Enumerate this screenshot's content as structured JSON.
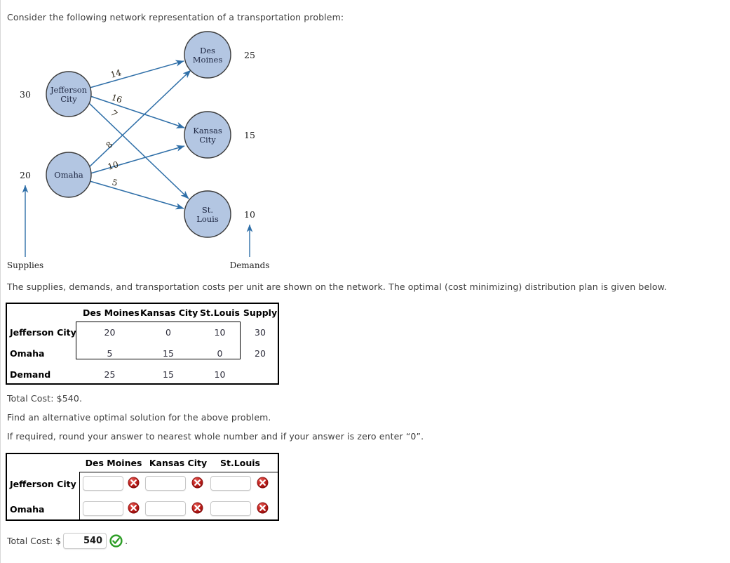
{
  "intro": {
    "text": "Consider the following network representation of a transportation problem:"
  },
  "network": {
    "supplies_label": "Supplies",
    "demands_label": "Demands",
    "sources": [
      {
        "name_line1": "Jefferson",
        "name_line2": "City",
        "supply": "30"
      },
      {
        "name_line1": "Omaha",
        "name_line2": "",
        "supply": "20"
      }
    ],
    "destinations": [
      {
        "name_line1": "Des",
        "name_line2": "Moines",
        "demand": "25"
      },
      {
        "name_line1": "Kansas",
        "name_line2": "City",
        "demand": "15"
      },
      {
        "name_line1": "St.",
        "name_line2": "Louis",
        "demand": "10"
      }
    ],
    "arc_costs": {
      "jefferson_des_moines": "14",
      "jefferson_kansas_city": "16",
      "jefferson_st_louis": "7",
      "omaha_des_moines": "8",
      "omaha_kansas_city": "10",
      "omaha_st_louis": "5"
    },
    "node_fill": "#b3c6e2",
    "node_stroke": "#3b3b3b",
    "arc_color": "#2f6fa8"
  },
  "description": {
    "text": "The supplies, demands, and transportation costs per unit are shown on the network. The optimal (cost minimizing) distribution plan is given below."
  },
  "solution_table": {
    "headers": [
      "",
      "Des Moines",
      "Kansas City",
      "St.Louis",
      "Supply"
    ],
    "rows": [
      {
        "label": "Jefferson City",
        "values": [
          "20",
          "0",
          "10"
        ],
        "supply": "30"
      },
      {
        "label": "Omaha",
        "values": [
          "5",
          "15",
          "0"
        ],
        "supply": "20"
      }
    ],
    "demand_row": {
      "label": "Demand",
      "values": [
        "25",
        "15",
        "10"
      ]
    }
  },
  "total_cost_static": {
    "text": "Total Cost: $540."
  },
  "question": {
    "find_alternative": "Find an alternative optimal solution for the above problem.",
    "rounding_note": "If required, round your answer to nearest whole number and if your answer is zero enter “0”."
  },
  "answer_table": {
    "headers": [
      "",
      "Des Moines",
      "Kansas City",
      "St.Louis"
    ],
    "rows": [
      {
        "label": "Jefferson City",
        "cells": [
          {
            "value": "",
            "placeholder": "",
            "status_icon": "error-x-icon"
          },
          {
            "value": "",
            "placeholder": "",
            "status_icon": "error-x-icon"
          },
          {
            "value": "",
            "placeholder": "",
            "status_icon": "error-x-icon"
          }
        ]
      },
      {
        "label": "Omaha",
        "cells": [
          {
            "value": "",
            "placeholder": "",
            "status_icon": "error-x-icon"
          },
          {
            "value": "",
            "placeholder": "",
            "status_icon": "error-x-icon"
          },
          {
            "value": "",
            "placeholder": "",
            "status_icon": "error-x-icon"
          }
        ]
      }
    ]
  },
  "total_cost_answer": {
    "label": "Total Cost: $",
    "value": "540",
    "placeholder": "",
    "status_icon": "success-check-icon",
    "trailing": "."
  },
  "colors": {
    "error_red": "#b71c1c",
    "success_green": "#2e9e27",
    "text": "#3d3d3d"
  }
}
